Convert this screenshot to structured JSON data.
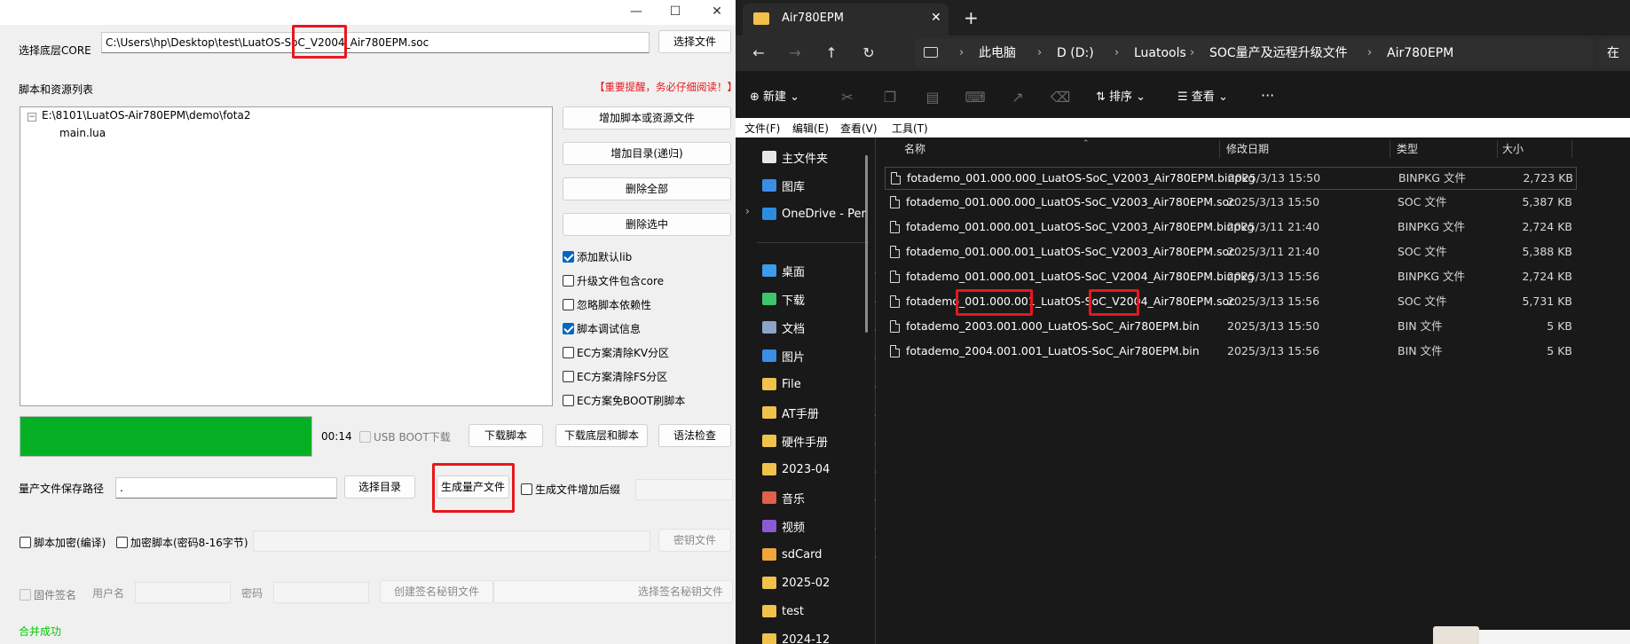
{
  "luatools": {
    "core_label": "选择底层CORE",
    "core_path": "C:\\Users\\hp\\Desktop\\test\\LuatOS-SoC_V2004_Air780EPM.soc",
    "choose_file": "选择文件",
    "scripts_label": "脚本和资源列表",
    "warning": "【重要提醒，务必仔细阅读！】",
    "tree": {
      "root": "E:\\8101\\LuatOS-Air780EPM\\demo\\fota2",
      "child": "main.lua"
    },
    "side_buttons": [
      "增加脚本或资源文件",
      "增加目录(递归)",
      "删除全部",
      "删除选中"
    ],
    "checks": [
      {
        "label": "添加默认lib",
        "checked": true
      },
      {
        "label": "升级文件包含core",
        "checked": false
      },
      {
        "label": "忽略脚本依赖性",
        "checked": false
      },
      {
        "label": "脚本调试信息",
        "checked": true
      },
      {
        "label": "EC方案清除KV分区",
        "checked": false
      },
      {
        "label": "EC方案清除FS分区",
        "checked": false
      },
      {
        "label": "EC方案免BOOT刷脚本",
        "checked": false
      }
    ],
    "progress": 1.0,
    "progress_color": "#06b025",
    "time": "00:14",
    "usb_boot": "USB BOOT下载",
    "download_script": "下载脚本",
    "download_core_script": "下载底层和脚本",
    "syntax_check": "语法检查",
    "output_label": "量产文件保存路径",
    "output_path": ".",
    "choose_dir": "选择目录",
    "gen_mass": "生成量产文件",
    "add_suffix": "生成文件增加后缀",
    "encrypt_compile": "脚本加密(编译)",
    "encrypt_pw": "加密脚本(密码8-16字节)",
    "key_file": "密钥文件",
    "fw_sign": "固件签名",
    "username": "用户名",
    "password": "密码",
    "create_key": "创建签名秘钥文件",
    "choose_key": "选择签名秘钥文件",
    "status": "合并成功",
    "status_color": "#00c800"
  },
  "explorer": {
    "tab_title": "Air780EPM",
    "breadcrumb": [
      "此电脑",
      "D (D:)",
      "Luatools",
      "SOC量产及远程升级文件",
      "Air780EPM"
    ],
    "search_partial": "在",
    "commands": {
      "new": "新建",
      "sort": "排序",
      "view": "查看",
      "more": "···"
    },
    "menu": [
      "文件(F)",
      "编辑(E)",
      "查看(V)",
      "工具(T)"
    ],
    "nav": [
      {
        "label": "主文件夹",
        "icon": "home-icon",
        "color": "#e8e8e8",
        "pin": false
      },
      {
        "label": "图库",
        "icon": "gallery-icon",
        "color": "#3a8ee6",
        "pin": false
      },
      {
        "label": "OneDrive - Per",
        "icon": "onedrive-icon",
        "color": "#2b8de0",
        "pin": false
      },
      {
        "label": "桌面",
        "icon": "desktop-icon",
        "color": "#3d9be9",
        "pin": true
      },
      {
        "label": "下载",
        "icon": "download-icon",
        "color": "#3ec46d",
        "pin": true
      },
      {
        "label": "文档",
        "icon": "document-icon",
        "color": "#8aa4c8",
        "pin": true
      },
      {
        "label": "图片",
        "icon": "pictures-icon",
        "color": "#3a8ee6",
        "pin": true
      },
      {
        "label": "File",
        "icon": "folder-icon",
        "color": "#f0c24b",
        "pin": true
      },
      {
        "label": "AT手册",
        "icon": "folder-icon",
        "color": "#f0c24b",
        "pin": true
      },
      {
        "label": "硬件手册",
        "icon": "folder-icon",
        "color": "#f0c24b",
        "pin": true
      },
      {
        "label": "2023-04",
        "icon": "folder-icon",
        "color": "#f0c24b",
        "pin": true
      },
      {
        "label": "音乐",
        "icon": "music-icon",
        "color": "#e0604a",
        "pin": true
      },
      {
        "label": "视频",
        "icon": "video-icon",
        "color": "#8a5ad6",
        "pin": true
      },
      {
        "label": "sdCard",
        "icon": "folder-icon",
        "color": "#f0a63b",
        "pin": true
      },
      {
        "label": "2025-02",
        "icon": "folder-icon",
        "color": "#f0c24b",
        "pin": false
      },
      {
        "label": "test",
        "icon": "folder-icon",
        "color": "#f0c24b",
        "pin": false
      },
      {
        "label": "2024-12",
        "icon": "folder-icon",
        "color": "#f0c24b",
        "pin": false
      }
    ],
    "columns": [
      "名称",
      "修改日期",
      "类型",
      "大小"
    ],
    "files": [
      {
        "name": "fotademo_001.000.000_LuatOS-SoC_V2003_Air780EPM.binpkg",
        "date": "2025/3/13 15:50",
        "type": "BINPKG 文件",
        "size": "2,723 KB"
      },
      {
        "name": "fotademo_001.000.000_LuatOS-SoC_V2003_Air780EPM.soc",
        "date": "2025/3/13 15:50",
        "type": "SOC 文件",
        "size": "5,387 KB"
      },
      {
        "name": "fotademo_001.000.001_LuatOS-SoC_V2003_Air780EPM.binpkg",
        "date": "2025/3/11 21:40",
        "type": "BINPKG 文件",
        "size": "2,724 KB"
      },
      {
        "name": "fotademo_001.000.001_LuatOS-SoC_V2003_Air780EPM.soc",
        "date": "2025/3/11 21:40",
        "type": "SOC 文件",
        "size": "5,388 KB"
      },
      {
        "name": "fotademo_001.000.001_LuatOS-SoC_V2004_Air780EPM.binpkg",
        "date": "2025/3/13 15:56",
        "type": "BINPKG 文件",
        "size": "2,724 KB"
      },
      {
        "name": "fotademo_001.000.001_LuatOS-SoC_V2004_Air780EPM.soc",
        "date": "2025/3/13 15:56",
        "type": "SOC 文件",
        "size": "5,731 KB"
      },
      {
        "name": "fotademo_2003.001.000_LuatOS-SoC_Air780EPM.bin",
        "date": "2025/3/13 15:50",
        "type": "BIN 文件",
        "size": "5 KB"
      },
      {
        "name": "fotademo_2004.001.001_LuatOS-SoC_Air780EPM.bin",
        "date": "2025/3/13 15:56",
        "type": "BIN 文件",
        "size": "5 KB"
      }
    ]
  }
}
